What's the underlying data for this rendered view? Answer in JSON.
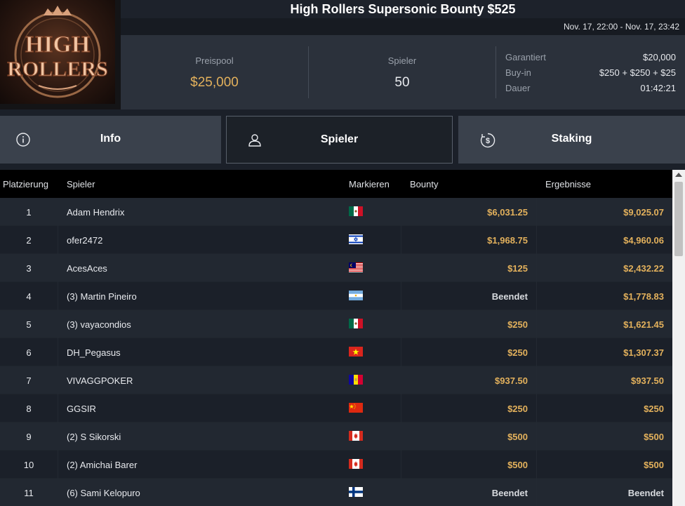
{
  "logo": {
    "line1": "HIGH",
    "line2": "ROLLERS"
  },
  "title": "High Rollers Supersonic Bounty $525",
  "date_range": "Nov. 17, 22:00 - Nov. 17, 23:42",
  "stats": {
    "prizepool_label": "Preispool",
    "prizepool_value": "$25,000",
    "players_label": "Spieler",
    "players_value": "50",
    "guaranteed_label": "Garantiert",
    "guaranteed_value": "$20,000",
    "buyin_label": "Buy-in",
    "buyin_value": "$250 + $250 + $25",
    "duration_label": "Dauer",
    "duration_value": "01:42:21"
  },
  "tabs": [
    {
      "label": "Info",
      "icon": "info-icon",
      "active": false
    },
    {
      "label": "Spieler",
      "icon": "user-icon",
      "active": true
    },
    {
      "label": "Staking",
      "icon": "dollar-icon",
      "active": false
    }
  ],
  "table": {
    "headers": {
      "place": "Platzierung",
      "player": "Spieler",
      "mark": "Markieren",
      "bounty": "Bounty",
      "results": "Ergebnisse"
    },
    "rows": [
      {
        "place": "1",
        "name": "Adam Hendrix",
        "flag": "mexico",
        "bounty": "$6,031.25",
        "result": "$9,025.07"
      },
      {
        "place": "2",
        "name": "ofer2472",
        "flag": "israel",
        "bounty": "$1,968.75",
        "result": "$4,960.06"
      },
      {
        "place": "3",
        "name": "AcesAces",
        "flag": "malaysia",
        "bounty": "$125",
        "result": "$2,432.22"
      },
      {
        "place": "4",
        "name": "(3) Martin Pineiro",
        "flag": "argentina",
        "bounty": "Beendet",
        "result": "$1,778.83"
      },
      {
        "place": "5",
        "name": "(3) vayacondios",
        "flag": "mexico",
        "bounty": "$250",
        "result": "$1,621.45"
      },
      {
        "place": "6",
        "name": "DH_Pegasus",
        "flag": "vietnam",
        "bounty": "$250",
        "result": "$1,307.37"
      },
      {
        "place": "7",
        "name": "VIVAGGPOKER",
        "flag": "andorra",
        "bounty": "$937.50",
        "result": "$937.50"
      },
      {
        "place": "8",
        "name": "GGSIR",
        "flag": "china",
        "bounty": "$250",
        "result": "$250"
      },
      {
        "place": "9",
        "name": "(2) S Sikorski",
        "flag": "canada",
        "bounty": "$500",
        "result": "$500"
      },
      {
        "place": "10",
        "name": "(2) Amichai Barer",
        "flag": "canada",
        "bounty": "$500",
        "result": "$500"
      },
      {
        "place": "11",
        "name": "(6) Sami Kelopuro",
        "flag": "finland",
        "bounty": "Beendet",
        "result": "Beendet"
      }
    ]
  },
  "colors": {
    "accent_gold": "#e3b15c",
    "background": "#1b2029",
    "tab_inactive": "#3a414c",
    "tab_active": "#1c2128"
  }
}
